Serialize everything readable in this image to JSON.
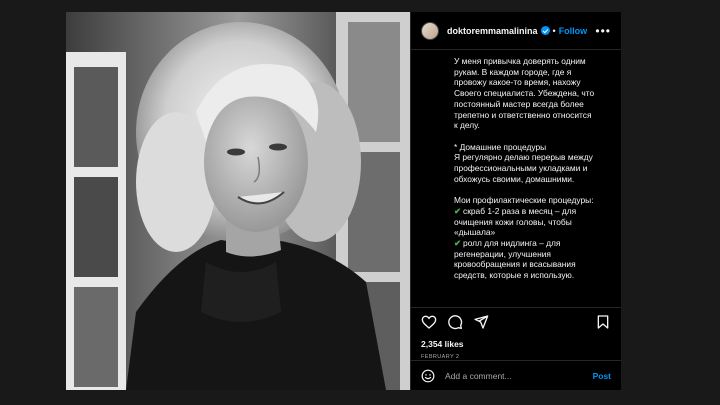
{
  "post": {
    "username": "doktoremmamalinina",
    "separator": "•",
    "follow_label": "Follow",
    "more_label": "•••",
    "caption_lines": [
      {
        "text": "У меня привычка доверять одним"
      },
      {
        "text": "рукам. В каждом городе, где я"
      },
      {
        "text": "провожу какое-то время, нахожу"
      },
      {
        "text": "Своего специалиста. Убеждена, что"
      },
      {
        "text": "постоянный мастер всегда более"
      },
      {
        "text": "трепетно и ответственно относится"
      },
      {
        "text": "к делу."
      },
      {
        "text": ""
      },
      {
        "text": "* Домашние процедуры"
      },
      {
        "text": "Я регулярно делаю перерыв между"
      },
      {
        "text": "профессиональными укладками и"
      },
      {
        "text": "обхожусь своими, домашними."
      },
      {
        "text": ""
      },
      {
        "text": "Мои профилактические процедуры:"
      },
      {
        "text": "скраб 1-2 раза в месяц – для",
        "check": "✔"
      },
      {
        "text": "очищения кожи головы, чтобы"
      },
      {
        "text": "«дышала»"
      },
      {
        "text": "ролл для нидлинга – для",
        "check": "✔"
      },
      {
        "text": "регенерации, улучшения"
      },
      {
        "text": "кровообращения и всасывания"
      },
      {
        "text": "средств, которые я использую."
      }
    ],
    "likes": "2,354 likes",
    "date": "FEBRUARY 2",
    "comment_placeholder": "Add a comment...",
    "post_label": "Post"
  },
  "icons": {
    "like": "heart-icon",
    "comment": "comment-icon",
    "share": "share-icon",
    "save": "bookmark-icon",
    "emoji": "emoji-icon",
    "verified": "verified-badge-icon"
  },
  "colors": {
    "background": "#191919",
    "panel": "#000000",
    "accent": "#0095f6",
    "check": "#4caf50"
  }
}
